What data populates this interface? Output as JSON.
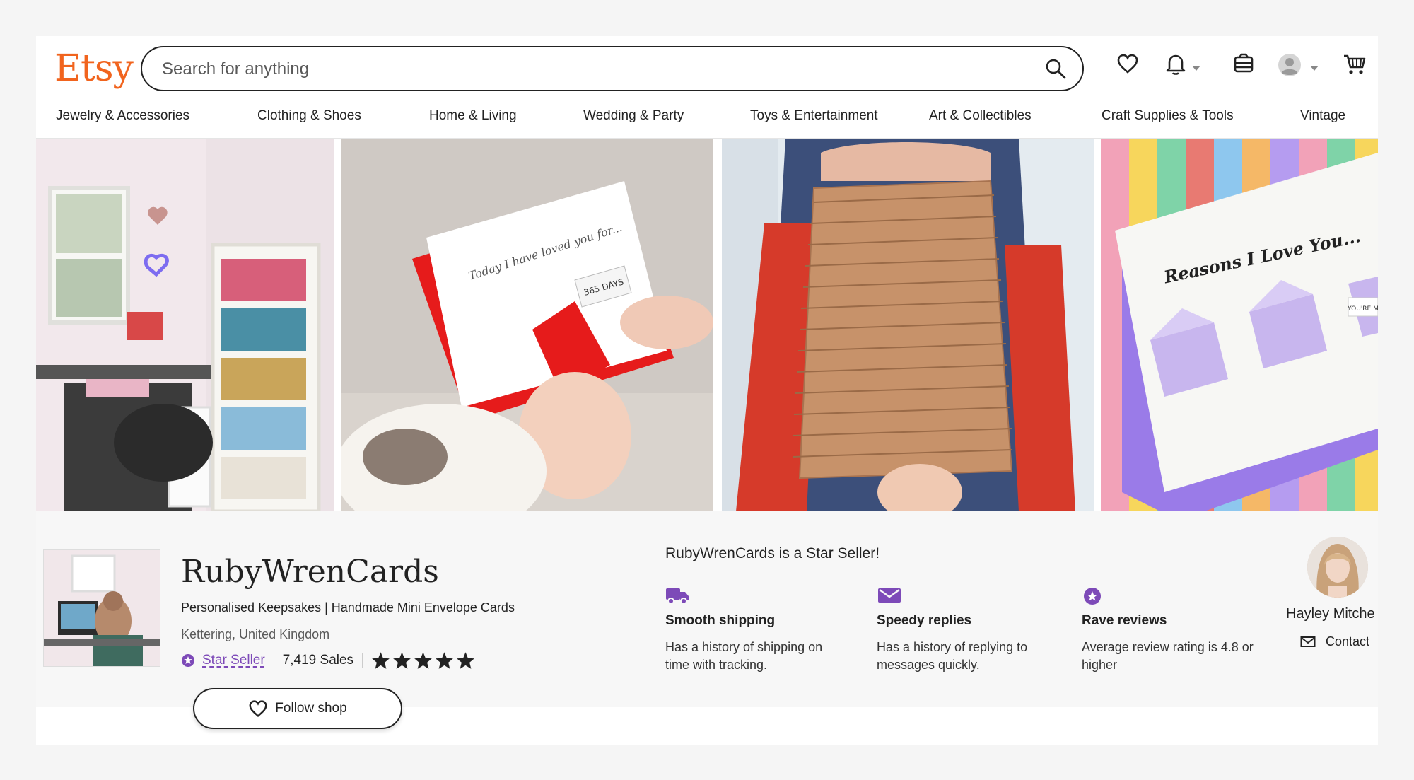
{
  "brand": {
    "logo_text": "Etsy",
    "color": "#F1641E"
  },
  "search": {
    "placeholder": "Search for anything"
  },
  "header_icons": [
    "heart-icon",
    "bell-icon",
    "gift-icon",
    "account-icon",
    "cart-icon"
  ],
  "categories": [
    "Jewelry & Accessories",
    "Clothing & Shoes",
    "Home & Living",
    "Wedding & Party",
    "Toys & Entertainment",
    "Art & Collectibles",
    "Craft Supplies & Tools",
    "Vintage"
  ],
  "banner": {
    "card1_text": "Today I have loved you for...",
    "card1_tag": "365 DAYS",
    "card2_text": "Reasons I Love You...",
    "card2_tag": "YOU'RE M"
  },
  "shop": {
    "name": "RubyWrenCards",
    "title": "Personalised Keepsakes | Handmade Mini Envelope Cards",
    "location": "Kettering, United Kingdom",
    "star_seller_label": "Star Seller",
    "sales": "7,419 Sales",
    "rating_stars": 5,
    "follow_label": "Follow shop"
  },
  "star_seller": {
    "heading": "RubyWrenCards is a Star Seller!",
    "accent_color": "#7d4ab8",
    "features": [
      {
        "icon": "truck-icon",
        "title": "Smooth shipping",
        "desc": "Has a history of shipping on time with tracking."
      },
      {
        "icon": "message-icon",
        "title": "Speedy replies",
        "desc": "Has a history of replying to messages quickly."
      },
      {
        "icon": "star-badge-icon",
        "title": "Rave reviews",
        "desc": "Average review rating is 4.8 or higher"
      }
    ]
  },
  "owner": {
    "name": "Hayley Mitche",
    "contact_label": "Contact"
  }
}
